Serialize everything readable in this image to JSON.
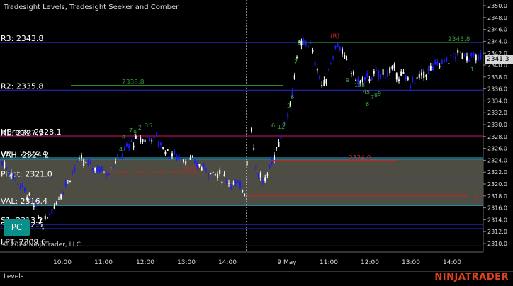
{
  "chart_title": "Tradesight Levels, Tradesight Seeker and Comber",
  "levels": [
    {
      "label": "R3: 2343.8",
      "price": 2343.8,
      "color": "#2b2bd9"
    },
    {
      "label": "R2: 2335.8",
      "price": 2335.8,
      "color": "#2b2bd9"
    },
    {
      "label": "HBreak: 2328.1",
      "price": 2328.1,
      "color": "#d4145a"
    },
    {
      "label": "R1: 2327.9",
      "price": 2327.9,
      "color": "#2b2bd9"
    },
    {
      "label": "VPT: 2324.4",
      "price": 2324.4,
      "color": "#2bb7d9"
    },
    {
      "label": "VAH: 2324.2",
      "price": 2324.2,
      "color": "#2bb7d9"
    },
    {
      "label": "Pivot: 2321.0",
      "price": 2321.0,
      "color": "#2b2bd9"
    },
    {
      "label": "VAL: 2316.4",
      "price": 2316.4,
      "color": "#2bb7d9"
    },
    {
      "label": "S1: 2313.2",
      "price": 2313.2,
      "color": "#2b2bd9"
    },
    {
      "label": "S2: 2312.5",
      "price": 2312.5,
      "color": "#2b2bd9"
    },
    {
      "label": "LPT: 2309.6",
      "price": 2309.6,
      "color": "#b03a8a"
    }
  ],
  "price_axis_ticks": [
    "2350.0",
    "2348.0",
    "2346.0",
    "2344.0",
    "2342.0",
    "2340.0",
    "2338.0",
    "2336.0",
    "2334.0",
    "2332.0",
    "2330.0",
    "2328.0",
    "2326.0",
    "2324.0",
    "2322.0",
    "2320.0",
    "2318.0",
    "2316.0",
    "2314.0",
    "2312.0",
    "2310.0"
  ],
  "current_price": "2341.3",
  "time_axis_ticks": [
    "10:00",
    "11:00",
    "12:00",
    "13:00",
    "14:00",
    "9 May",
    "11:00",
    "12:00",
    "13:00",
    "14:00"
  ],
  "annotations": [
    "2338.8",
    "2343.8",
    "2324.0",
    "(R)",
    "2"
  ],
  "seeker_counts": [
    "4",
    "7",
    "8",
    "9",
    "2",
    "3",
    "5",
    "6",
    "12",
    "4",
    "5",
    "6",
    "7",
    "8",
    "9",
    "123",
    "45",
    "6",
    "7",
    "8",
    "9",
    "1"
  ],
  "pc_button": "PC",
  "copyright": "© 2024 NinjaTrader, LLC",
  "tab_label": "Levels",
  "brand": "NINJATRADER",
  "colors": {
    "up": "#ffffff",
    "down": "#1a1aff",
    "value_area": "#5a5a50",
    "bg": "#000000"
  }
}
